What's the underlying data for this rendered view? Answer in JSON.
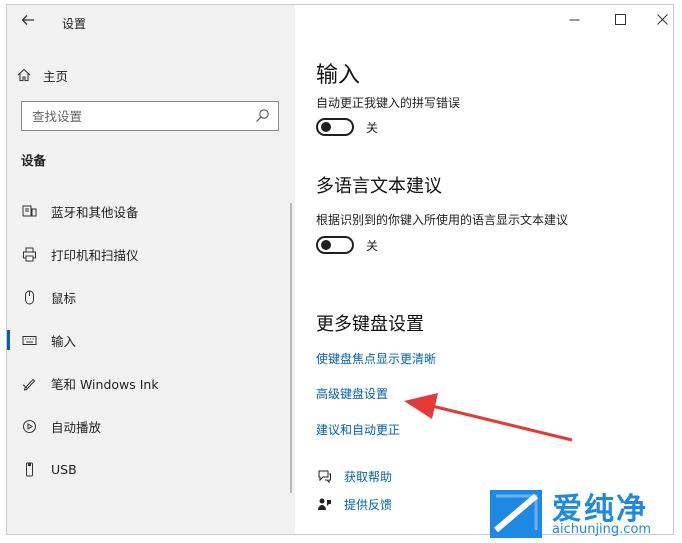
{
  "window": {
    "title": "设置",
    "back_icon": "arrow-left-icon",
    "minimize_glyph": "—",
    "maximize_glyph": "☐",
    "close_glyph": "✕"
  },
  "sidebar": {
    "home_label": "主页",
    "search_placeholder": "查找设置",
    "section_title": "设备",
    "items": [
      {
        "label": "蓝牙和其他设备",
        "icon": "bluetooth-devices-icon"
      },
      {
        "label": "打印机和扫描仪",
        "icon": "printer-icon"
      },
      {
        "label": "鼠标",
        "icon": "mouse-icon"
      },
      {
        "label": "输入",
        "icon": "keyboard-icon",
        "selected": true
      },
      {
        "label": "笔和 Windows Ink",
        "icon": "pen-icon"
      },
      {
        "label": "自动播放",
        "icon": "autoplay-icon"
      },
      {
        "label": "USB",
        "icon": "usb-icon"
      }
    ]
  },
  "content": {
    "page_title": "输入",
    "autocorrect": {
      "label": "自动更正我键入的拼写错误",
      "state_text": "关",
      "on": false
    },
    "multilingual": {
      "heading": "多语言文本建议",
      "description": "根据识别到的你键入所使用的语言显示文本建议",
      "state_text": "关",
      "on": false
    },
    "more_keyboard": {
      "heading": "更多键盘设置",
      "links": [
        "使键盘焦点显示更清晰",
        "高级键盘设置",
        "建议和自动更正"
      ]
    },
    "help": {
      "get_help": "获取帮助",
      "feedback": "提供反馈"
    }
  },
  "watermark": {
    "brand": "爱纯净",
    "url": "aichunjing.com"
  },
  "colors": {
    "accent": "#0063b1",
    "arrow": "#e53935",
    "watermark_blue": "#1e88e5",
    "sidebar_bg": "#f2f2f2"
  }
}
